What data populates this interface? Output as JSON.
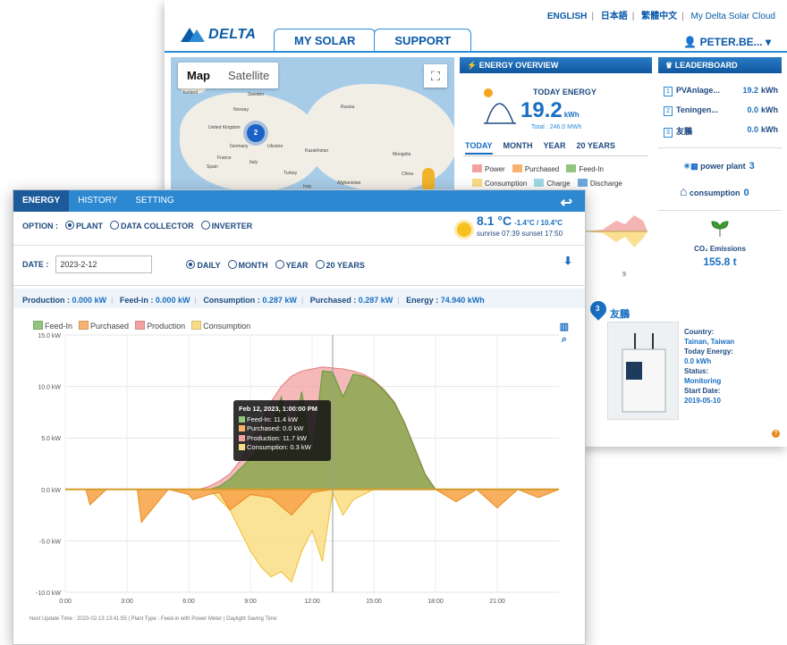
{
  "portal": {
    "toplinks": {
      "english": "ENGLISH",
      "japanese": "日本語",
      "chinese": "繁體中文",
      "cloud": "My Delta Solar Cloud"
    },
    "logo": "DELTA",
    "tabs": {
      "my_solar": "MY SOLAR",
      "support": "SUPPORT"
    },
    "user": "PETER.BE...",
    "map": {
      "map_label": "Map",
      "satellite_label": "Satellite",
      "cluster_count": "2",
      "places": [
        "Iceland",
        "Sweden",
        "Norway",
        "Russia",
        "United Kingdom",
        "Germany",
        "Ukraine",
        "Kazakhstan",
        "Mongolia",
        "France",
        "Italy",
        "Spain",
        "Turkey",
        "China",
        "Iraq",
        "Afghanistan"
      ]
    },
    "energy_overview": {
      "header": "ENERGY OVERVIEW",
      "today_label": "TODAY ENERGY",
      "today_value": "19.2",
      "today_unit": "kWh",
      "total": "Total : 246.0 MWh",
      "periods": {
        "today": "TODAY",
        "month": "MONTH",
        "year": "YEAR",
        "years20": "20 YEARS"
      },
      "legend": {
        "power": "Power",
        "purchased": "Purchased",
        "feed_in": "Feed-In",
        "consumption": "Consumption",
        "charge": "Charge",
        "discharge": "Discharge"
      },
      "mini_tick": "9"
    },
    "leaderboard": {
      "header": "LEADERBOARD",
      "rows": [
        {
          "rank": "1",
          "name": "PVAnlage...",
          "value": "19.2",
          "unit": "kWh"
        },
        {
          "rank": "2",
          "name": "Teningen...",
          "value": "0.0",
          "unit": "kWh"
        },
        {
          "rank": "3",
          "name": "友鵬",
          "value": "0.0",
          "unit": "kWh"
        }
      ],
      "power_plant_label": "power plant",
      "power_plant_count": "3",
      "consumption_label": "consumption",
      "consumption_count": "0",
      "co2_label": "CO₂ Emissions",
      "co2_value": "155.8 t"
    },
    "device": {
      "pin": "3",
      "name": "友鵬",
      "fields": {
        "country_k": "Country:",
        "country_v": "Tainan, Taiwan",
        "today_k": "Today Energy:",
        "today_v": "0.0 kWh",
        "status_k": "Status:",
        "status_v": "Monitoring",
        "start_k": "Start Date:",
        "start_v": "2019-05-10"
      }
    }
  },
  "front": {
    "tabs": {
      "energy": "ENERGY",
      "history": "HISTORY",
      "setting": "SETTING"
    },
    "option_label": "OPTION :",
    "options": {
      "plant": "PLANT",
      "collector": "DATA COLLECTOR",
      "inverter": "INVERTER"
    },
    "weather": {
      "temp": "8.1 °C",
      "range": "-1.4°C / 10.4°C",
      "sun": "sunrise 07:39 sunset 17:50"
    },
    "date_label": "DATE :",
    "date_value": "2023-2-12",
    "granularity": {
      "daily": "DAILY",
      "month": "MONTH",
      "year": "YEAR",
      "years20": "20 YEARS"
    },
    "summary": {
      "production_k": "Production :",
      "production_v": "0.000 kW",
      "feedin_k": "Feed-in :",
      "feedin_v": "0.000 kW",
      "consumption_k": "Consumption :",
      "consumption_v": "0.287 kW",
      "purchased_k": "Purchased :",
      "purchased_v": "0.287 kW",
      "energy_k": "Energy :",
      "energy_v": "74.940 kWh"
    },
    "legend": {
      "feed_in": "Feed-In",
      "purchased": "Purchased",
      "production": "Production",
      "consumption": "Consumption"
    },
    "tooltip": {
      "title": "Feb 12, 2023, 1:00:00 PM",
      "feed_in": "Feed-In: 11.4 kW",
      "purchased": "Purchased: 0.0 kW",
      "production": "Production: 11.7 kW",
      "consumption": "Consumption: 0.3 kW"
    },
    "footer": "Next Update Time : 2023-02-13 13:41:55  | Plant Type : Feed-in with Power Meter  | Daylight Saving Time"
  },
  "colors": {
    "feed_in": "#6aa84f",
    "purchased": "#f39a3b",
    "production": "#f08a8a",
    "consumption": "#f7d25a",
    "charge": "#9fd8e6",
    "discharge": "#6fa8dc",
    "accent": "#1a6fc2"
  },
  "chart_data": {
    "type": "area",
    "ylabel_ticks": [
      "15.0 kW",
      "10.0 kW",
      "5.0 kW",
      "0.0 kW",
      "-5.0 kW",
      "-10.0 kW"
    ],
    "x_ticks": [
      "0:00",
      "3:00",
      "6:00",
      "9:00",
      "12:00",
      "15:00",
      "18:00",
      "21:00"
    ],
    "ylim": [
      -10,
      15
    ],
    "xlim": [
      0,
      24
    ],
    "series": [
      {
        "name": "Production",
        "x": [
          0,
          6.5,
          7,
          7.5,
          8,
          8.5,
          9,
          9.5,
          10,
          10.5,
          11,
          11.5,
          12,
          12.5,
          13,
          13.5,
          14,
          14.5,
          15,
          15.5,
          16,
          16.5,
          17,
          17.5,
          18,
          24
        ],
        "values": [
          0,
          0,
          0.3,
          0.8,
          1.5,
          2.8,
          4.5,
          6.5,
          8.5,
          10,
          11,
          11.5,
          11.7,
          11.9,
          11.8,
          11.7,
          11.5,
          11.2,
          10.6,
          9.7,
          8.5,
          6.5,
          4,
          1.5,
          0,
          0
        ]
      },
      {
        "name": "Feed-In",
        "x": [
          0,
          6.5,
          7,
          7.5,
          8,
          8.5,
          9,
          9.5,
          10,
          10.5,
          11,
          11.5,
          12,
          12.5,
          13,
          13.5,
          14,
          14.5,
          15,
          15.5,
          16,
          16.5,
          17,
          17.5,
          18,
          24
        ],
        "values": [
          0,
          0,
          0,
          0.3,
          1,
          2,
          3,
          4.5,
          6,
          9,
          5,
          9.5,
          3,
          11.5,
          11.4,
          9,
          11.2,
          11,
          10.5,
          9.6,
          8.4,
          6.4,
          3.9,
          1.4,
          0,
          0
        ]
      },
      {
        "name": "Purchased",
        "x": [
          0,
          1,
          1.2,
          2,
          3.5,
          3.7,
          5,
          6,
          6.2,
          7,
          7.5,
          8,
          9,
          10,
          11,
          12,
          13,
          14,
          18,
          19,
          20,
          21,
          22,
          23,
          24
        ],
        "values": [
          0,
          0,
          -1.5,
          0,
          0,
          -3.2,
          0,
          -0.5,
          -1,
          -0.5,
          -0.3,
          -2,
          -0.5,
          -0.8,
          -2.5,
          -0.3,
          0,
          0,
          0,
          -1.2,
          0,
          -1.8,
          0,
          -0.8,
          0
        ]
      },
      {
        "name": "Consumption",
        "x": [
          0,
          7,
          8,
          8.5,
          9,
          9.5,
          10,
          10.5,
          11,
          11.5,
          12,
          12.5,
          13,
          13.5,
          14,
          15,
          18,
          24
        ],
        "values": [
          0,
          0,
          -2,
          -4,
          -6,
          -7.5,
          -8.5,
          -8,
          -9,
          -6,
          -4,
          -7,
          -0.3,
          -2.5,
          -1,
          0,
          0,
          0
        ]
      }
    ]
  }
}
